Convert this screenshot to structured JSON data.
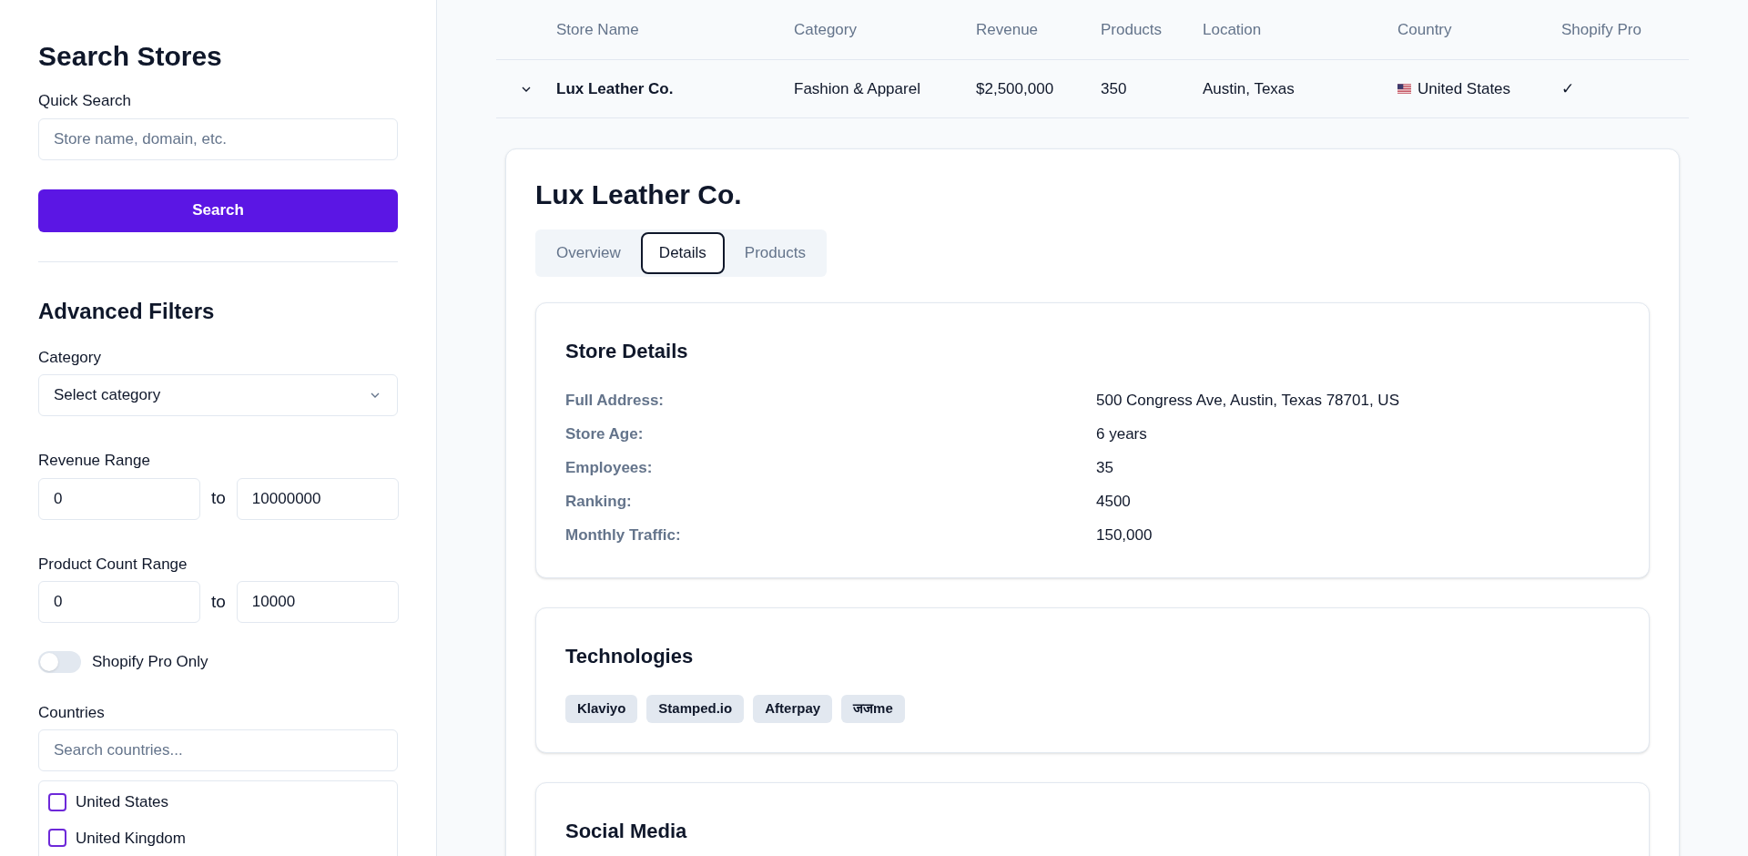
{
  "sidebar": {
    "title": "Search Stores",
    "quick_search": {
      "label": "Quick Search",
      "placeholder": "Store name, domain, etc."
    },
    "search_button": "Search",
    "advanced_title": "Advanced Filters",
    "category": {
      "label": "Category",
      "value": "Select category"
    },
    "revenue_range": {
      "label": "Revenue Range",
      "min": "0",
      "separator": "to",
      "max": "10000000"
    },
    "product_count_range": {
      "label": "Product Count Range",
      "min": "0",
      "separator": "to",
      "max": "10000"
    },
    "shopify_pro_toggle": {
      "label": "Shopify Pro Only",
      "on": false
    },
    "countries": {
      "label": "Countries",
      "placeholder": "Search countries...",
      "options": [
        {
          "label": "United States",
          "checked": false
        },
        {
          "label": "United Kingdom",
          "checked": false
        }
      ]
    }
  },
  "table": {
    "columns": [
      "Store Name",
      "Category",
      "Revenue",
      "Products",
      "Location",
      "Country",
      "Shopify Pro"
    ],
    "rows": [
      {
        "expanded": true,
        "store_name": "Lux Leather Co.",
        "category": "Fashion & Apparel",
        "revenue": "$2,500,000",
        "products": "350",
        "location": "Austin, Texas",
        "country": "United States",
        "shopify_pro": "✓"
      }
    ]
  },
  "detail": {
    "title": "Lux Leather Co.",
    "tabs": [
      {
        "label": "Overview",
        "selected": false
      },
      {
        "label": "Details",
        "selected": true
      },
      {
        "label": "Products",
        "selected": false
      }
    ],
    "store_details": {
      "title": "Store Details",
      "fields": [
        {
          "label": "Full Address:",
          "value": "500 Congress Ave, Austin, Texas 78701, US"
        },
        {
          "label": "Store Age:",
          "value": "6 years"
        },
        {
          "label": "Employees:",
          "value": "35"
        },
        {
          "label": "Ranking:",
          "value": "4500"
        },
        {
          "label": "Monthly Traffic:",
          "value": "150,000"
        }
      ]
    },
    "technologies": {
      "title": "Technologies",
      "tags": [
        "Klaviyo",
        "Stamped.io",
        "Afterpay",
        "जजme"
      ]
    },
    "social_media": {
      "title": "Social Media"
    }
  }
}
